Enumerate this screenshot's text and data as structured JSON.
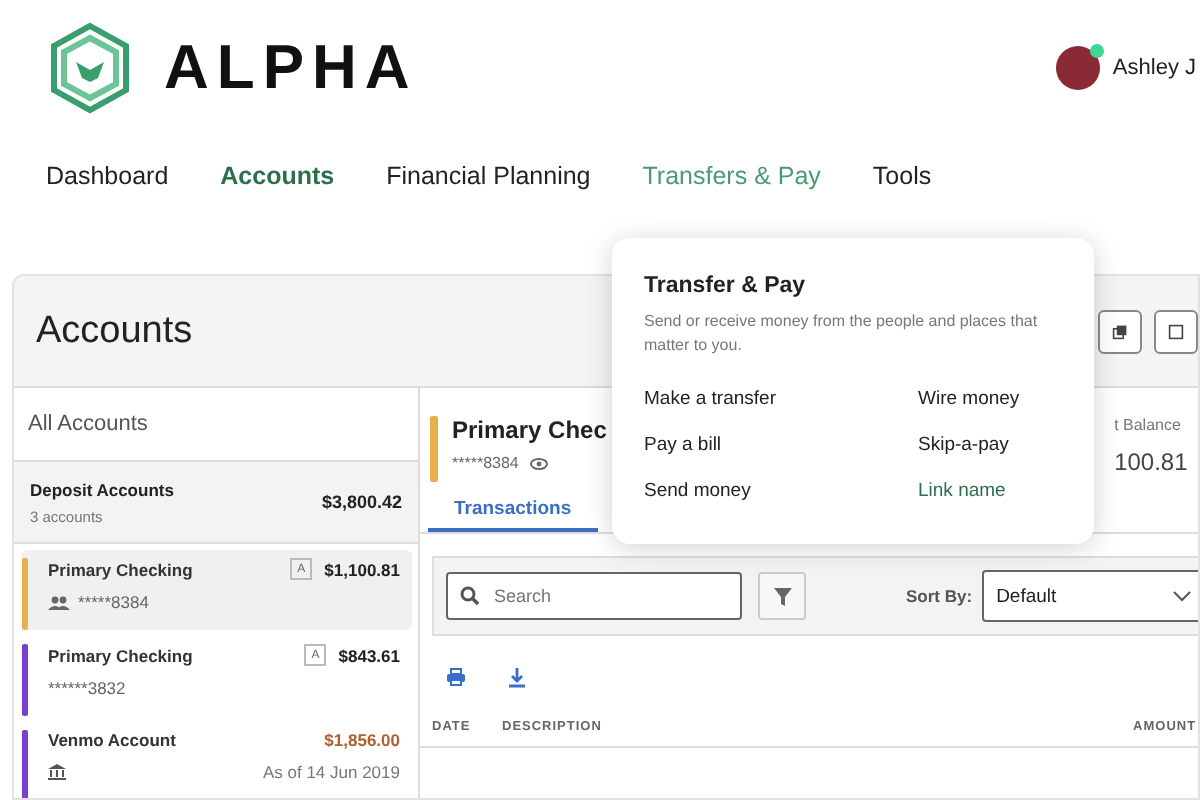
{
  "brand": {
    "name": "ALPHA"
  },
  "user": {
    "name": "Ashley J",
    "online": true
  },
  "nav": [
    {
      "label": "Dashboard",
      "selected": false,
      "hovered": false
    },
    {
      "label": "Accounts",
      "selected": true,
      "hovered": false
    },
    {
      "label": "Financial Planning",
      "selected": false,
      "hovered": false
    },
    {
      "label": "Transfers & Pay",
      "selected": false,
      "hovered": true
    },
    {
      "label": "Tools",
      "selected": false,
      "hovered": false
    }
  ],
  "page": {
    "title": "Accounts"
  },
  "sidebar": {
    "heading": "All Accounts",
    "group": {
      "name": "Deposit Accounts",
      "count": "3 accounts",
      "total": "$3,800.42"
    },
    "accounts": [
      {
        "kind": "shared",
        "name": "Primary Checking",
        "number": "*****8384",
        "badge": "A",
        "balance": "$1,100.81",
        "color": "#e8b04b",
        "selected": true
      },
      {
        "kind": "plain",
        "name": "Primary Checking",
        "number": "******3832",
        "badge": "A",
        "balance": "$843.61",
        "color": "#7b3fd0",
        "selected": false
      },
      {
        "kind": "external",
        "name": "Venmo Account",
        "as_of": "As of 14 Jun 2019",
        "balance": "$1,856.00",
        "color": "#7b3fd0",
        "selected": false
      }
    ]
  },
  "detail": {
    "title": "Primary Chec",
    "number": "*****8384",
    "color": "#e8b04b",
    "balance_label": "t Balance",
    "balance": "100.81",
    "tabs": [
      {
        "label": "Transactions",
        "selected": true
      }
    ],
    "search": {
      "placeholder": "Search"
    },
    "sort": {
      "label": "Sort By:",
      "value": "Default"
    },
    "columns": [
      "DATE",
      "DESCRIPTION",
      "AMOUNT"
    ]
  },
  "popover": {
    "title": "Transfer & Pay",
    "description": "Send or receive money from the people and places that matter to you.",
    "links": [
      {
        "label": "Make a transfer",
        "highlighted": false
      },
      {
        "label": "Wire money",
        "highlighted": false
      },
      {
        "label": "Pay a bill",
        "highlighted": false
      },
      {
        "label": "Skip-a-pay",
        "highlighted": false
      },
      {
        "label": "Send money",
        "highlighted": false
      },
      {
        "label": "Link name",
        "highlighted": true
      }
    ]
  }
}
